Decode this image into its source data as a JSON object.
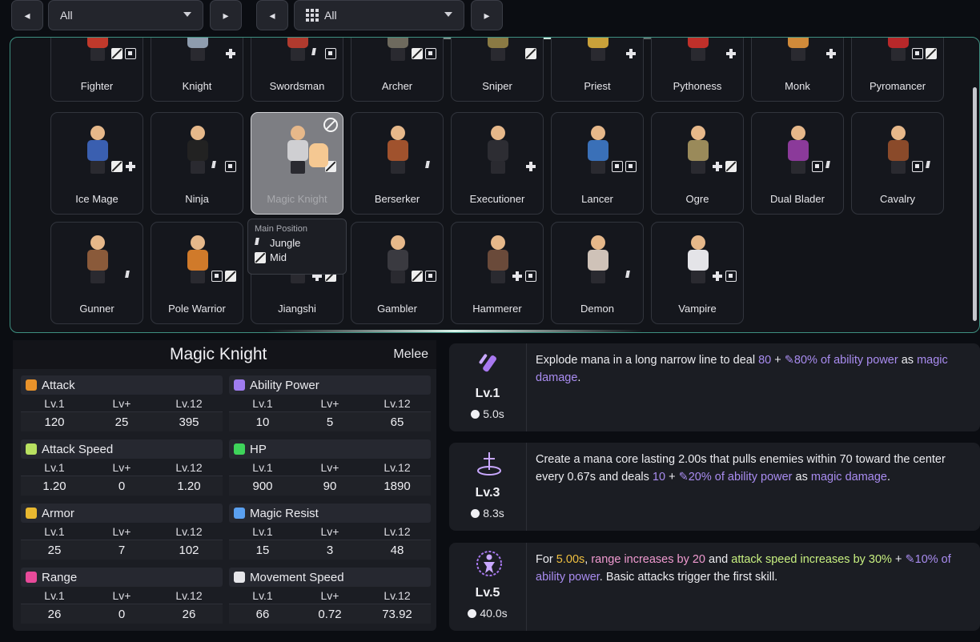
{
  "topbar": {
    "left_filter": {
      "prev_icon": "caret-left-icon",
      "value": "All",
      "next_icon": "caret-right-icon"
    },
    "right_filter": {
      "prev_icon": "caret-left-icon",
      "icon": "grid-icon",
      "value": "All",
      "next_icon": "caret-right-icon"
    }
  },
  "roster": {
    "row1": [
      "Fighter",
      "Knight",
      "Swordsman",
      "Archer",
      "Sniper",
      "Priest",
      "Pythoness",
      "Monk",
      "Pyromancer"
    ],
    "row2": [
      "Ice Mage",
      "Ninja",
      "Magic Knight",
      "Berserker",
      "Executioner",
      "Lancer",
      "Ogre",
      "Dual Blader",
      "Cavalry"
    ],
    "row3": [
      "Gunner",
      "Pole Warrior",
      "Jiangshi",
      "Gambler",
      "Hammerer",
      "Demon",
      "Vampire"
    ],
    "selected": "Magic Knight"
  },
  "tooltip": {
    "title": "Main Position",
    "positions": [
      "Jungle",
      "Mid"
    ]
  },
  "hero": {
    "name": "Magic Knight",
    "type": "Melee",
    "col_labels": [
      "Lv.1",
      "Lv+",
      "Lv.12"
    ],
    "stats": [
      {
        "name": "Attack",
        "icon": "sword-icon",
        "color": "#e8922a",
        "values": [
          "120",
          "25",
          "395"
        ]
      },
      {
        "name": "Ability Power",
        "icon": "wand-icon",
        "color": "#9f7cf0",
        "values": [
          "10",
          "5",
          "65"
        ]
      },
      {
        "name": "Attack Speed",
        "icon": "attack-speed-icon",
        "color": "#b8e060",
        "values": [
          "1.20",
          "0",
          "1.20"
        ]
      },
      {
        "name": "HP",
        "icon": "plus-icon",
        "color": "#3ed35a",
        "values": [
          "900",
          "90",
          "1890"
        ]
      },
      {
        "name": "Armor",
        "icon": "shield-icon",
        "color": "#e8b830",
        "values": [
          "25",
          "7",
          "102"
        ]
      },
      {
        "name": "Magic Resist",
        "icon": "magic-resist-icon",
        "color": "#5aa0f0",
        "values": [
          "15",
          "3",
          "48"
        ]
      },
      {
        "name": "Range",
        "icon": "range-icon",
        "color": "#e84a9a",
        "values": [
          "26",
          "0",
          "26"
        ]
      },
      {
        "name": "Movement Speed",
        "icon": "boot-icon",
        "color": "#e6e6ea",
        "values": [
          "66",
          "0.72",
          "73.92"
        ]
      }
    ]
  },
  "skills": [
    {
      "level": "Lv.1",
      "cooldown": "5.0s",
      "icon": "mana-line-icon",
      "desc": [
        {
          "t": "Explode mana in a long narrow line to deal "
        },
        {
          "t": "80",
          "c": "p"
        },
        {
          "t": " + "
        },
        {
          "t": "✎80% of ability power",
          "c": "p"
        },
        {
          "t": " as "
        },
        {
          "t": "magic damage",
          "c": "p"
        },
        {
          "t": "."
        }
      ]
    },
    {
      "level": "Lv.3",
      "cooldown": "8.3s",
      "icon": "mana-core-icon",
      "desc": [
        {
          "t": "Create a mana core lasting 2.00s that pulls enemies within 70 toward the center every 0.67s and deals "
        },
        {
          "t": "10",
          "c": "p"
        },
        {
          "t": " + "
        },
        {
          "t": "✎20% of ability power",
          "c": "p"
        },
        {
          "t": " as "
        },
        {
          "t": "magic damage",
          "c": "p"
        },
        {
          "t": "."
        }
      ]
    },
    {
      "level": "Lv.5",
      "cooldown": "40.0s",
      "icon": "empower-icon",
      "desc": [
        {
          "t": "For "
        },
        {
          "t": "5.00s",
          "c": "y"
        },
        {
          "t": ", "
        },
        {
          "t": "range increases by 20",
          "c": "pk"
        },
        {
          "t": " and "
        },
        {
          "t": "attack speed increases by 30%",
          "c": "g"
        },
        {
          "t": " + "
        },
        {
          "t": "✎10% of ability power",
          "c": "p"
        },
        {
          "t": ". Basic attacks trigger the first skill."
        }
      ]
    }
  ]
}
